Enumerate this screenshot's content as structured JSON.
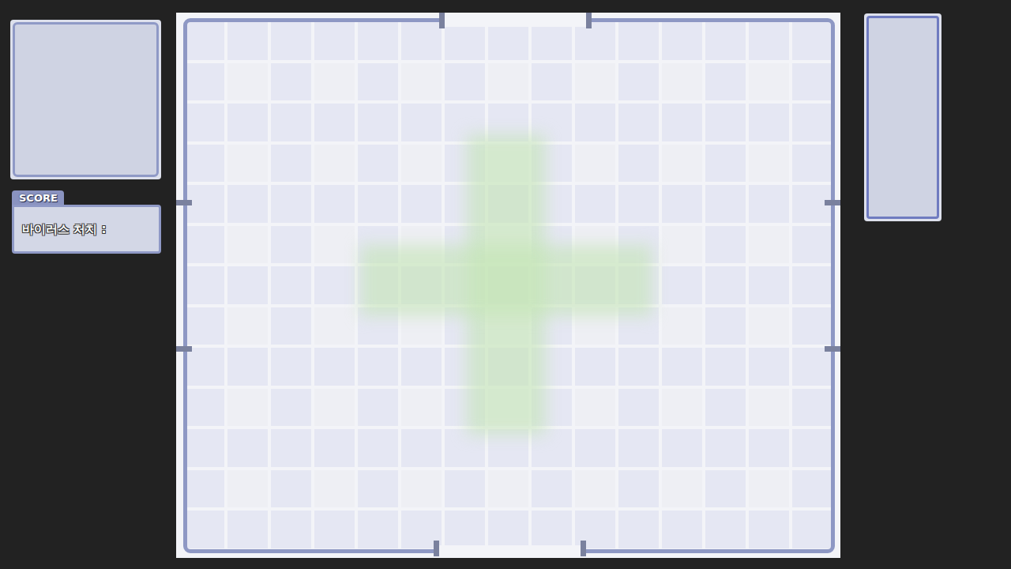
{
  "score": {
    "tab": "SCORE",
    "label": "바이러스 처치 :"
  }
}
